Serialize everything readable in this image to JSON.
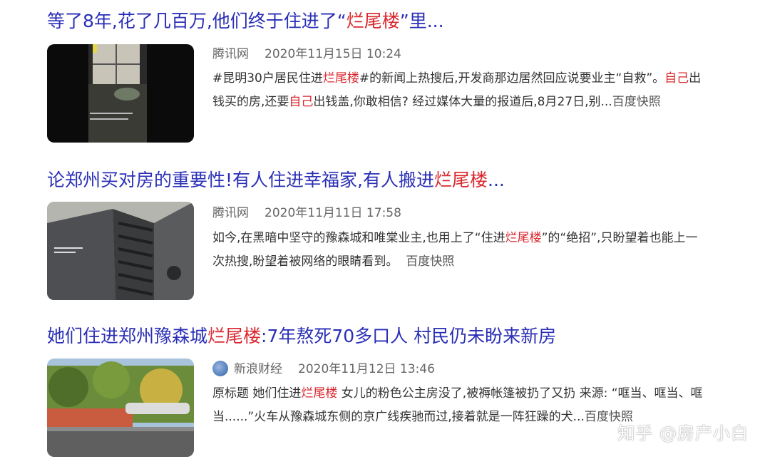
{
  "results": [
    {
      "title_parts": [
        "等了8年,花了几百万,他们终于住进了“",
        "烂尾楼",
        "”里..."
      ],
      "source": "腾讯网",
      "date": "2020年11月15日 10:24",
      "snippet_parts": [
        "#昆明30户居民住进",
        "烂尾楼",
        "#的新闻上热搜后,开发商那边居然回应说要业主“自救”。",
        "自己",
        "出钱买的房,还要",
        "自己",
        "出钱盖,你敢相信? 经过媒体大量的报道后,8月27日,别..."
      ],
      "cache_label": "百度快照"
    },
    {
      "title_parts": [
        "论郑州买对房的重要性!有人住进幸福家,有人搬进",
        "烂尾楼",
        "..."
      ],
      "source": "腾讯网",
      "date": "2020年11月11日 17:58",
      "snippet_parts": [
        "如今,在黑暗中坚守的豫森城和唯棠业主,也用上了“住进",
        "烂尾楼",
        "”的“绝招”,只盼望着也能上一次热搜,盼望着被网络的眼睛看到。"
      ],
      "cache_label": "百度快照"
    },
    {
      "title_parts": [
        "她们住进郑州豫森城",
        "烂尾楼",
        ":7年熬死70多口人 村民仍未盼来新房"
      ],
      "source": "新浪财经",
      "date": "2020年11月12日 13:46",
      "snippet_parts": [
        "原标题 她们住进",
        "烂尾楼",
        " 女儿的粉色公主房没了,被褥帐篷被扔了又扔 来源: “哐当、哐当、哐当......”火车从豫森城东侧的京广线疾驰而过,接着就是一阵狂躁的犬..."
      ],
      "cache_label": "百度快照"
    }
  ],
  "watermark": "知乎 @房产小白",
  "colors": {
    "title": "#2a2fb6",
    "highlight": "#d9272e",
    "meta": "#666666"
  }
}
